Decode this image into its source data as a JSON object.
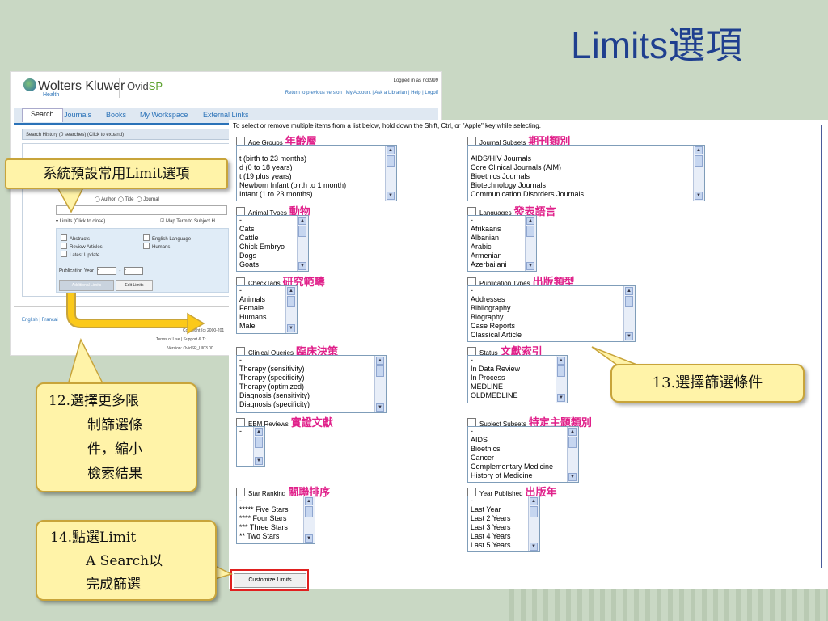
{
  "slide": {
    "title": "Limits選項"
  },
  "ovid": {
    "brand": "Wolters Kluwer",
    "brand_sub": "Health",
    "product_a": "Ovid",
    "product_b": "SP",
    "logged_in": "Logged in as nck999",
    "top_links": "Return to previous version | My Account | Ask a Librarian | Help | Logoff",
    "tabs": [
      "Search",
      "Journals",
      "Books",
      "My Workspace",
      "External Links"
    ],
    "search_history": "Search History (0 searches) (Click to expand)",
    "radio_author": "Author",
    "radio_title": "Title",
    "radio_journal": "Journal",
    "limits_header": "▾ Limits (Click to close)",
    "map_term": "Map Term to Subject H",
    "checks": [
      "Abstracts",
      "Review Articles",
      "Latest Update",
      "English Language",
      "Humans"
    ],
    "publication_year": "Publication Year",
    "year_from": "-",
    "year_to": "-",
    "additional_limits": "Additional Limits",
    "edit_limits": "Edit Limits",
    "lang_links": "English | Françai",
    "footer_copy": "Copyright (c) 2000-201",
    "footer_terms": "Terms of Use | Support & Tr",
    "footer_version": "Version: OvidSP_UI03.00"
  },
  "limits": {
    "instruction": "To select or remove multiple items from a list below, hold down the Shift, Ctrl, or \"Apple\" key while selecting.",
    "customize_button": "Customize Limits",
    "categories": {
      "age_groups": {
        "label": "Age Groups",
        "zh": "年齡層",
        "options": [
          "-",
          "t (birth to 23 months)",
          "d (0 to 18 years)",
          "t (19 plus years)",
          "Newborn Infant (birth to 1 month)",
          "Infant (1 to 23 months)"
        ]
      },
      "journal_subsets": {
        "label": "Journal Subsets",
        "zh": "期刊類別",
        "options": [
          "-",
          "AIDS/HIV Journals",
          "Core Clinical Journals (AIM)",
          "Bioethics Journals",
          "Biotechnology Journals",
          "Communication Disorders Journals"
        ]
      },
      "animal_types": {
        "label": "Animal Types",
        "zh": "動物",
        "options": [
          "-",
          "Cats",
          "Cattle",
          "Chick Embryo",
          "Dogs",
          "Goats"
        ]
      },
      "languages": {
        "label": "Languages",
        "zh": "發表語言",
        "options": [
          "-",
          "Afrikaans",
          "Albanian",
          "Arabic",
          "Armenian",
          "Azerbaijani"
        ]
      },
      "checktags": {
        "label": "CheckTags",
        "zh": "研究範疇",
        "options": [
          "-",
          "Animals",
          "Female",
          "Humans",
          "Male"
        ]
      },
      "publication_types": {
        "label": "Publication Types",
        "zh": "出版類型",
        "options": [
          "-",
          "Addresses",
          "Bibliography",
          "Biography",
          "Case Reports",
          "Classical Article"
        ]
      },
      "clinical_queries": {
        "label": "Clinical Queries",
        "zh": "臨床決策",
        "options": [
          "-",
          "Therapy (sensitivity)",
          "Therapy (specificity)",
          "Therapy (optimized)",
          "Diagnosis (sensitivity)",
          "Diagnosis (specificity)"
        ]
      },
      "status": {
        "label": "Status",
        "zh": "文獻索引",
        "options": [
          "-",
          "In Data Review",
          "In Process",
          "MEDLINE",
          "OLDMEDLINE"
        ]
      },
      "ebm_reviews": {
        "label": "EBM Reviews",
        "zh": "實證文獻",
        "options": [
          "-"
        ]
      },
      "subject_subsets": {
        "label": "Subject Subsets",
        "zh": "特定主題類別",
        "options": [
          "-",
          "AIDS",
          "Bioethics",
          "Cancer",
          "Complementary Medicine",
          "History of Medicine"
        ]
      },
      "star_ranking": {
        "label": "Star Ranking",
        "zh": "關聯排序",
        "options": [
          "-",
          "***** Five Stars",
          "**** Four Stars",
          "*** Three Stars",
          "** Two Stars"
        ]
      },
      "year_published": {
        "label": "Year Published",
        "zh": "出版年",
        "options": [
          "-",
          "Last Year",
          "Last 2 Years",
          "Last 3 Years",
          "Last 4 Years",
          "Last 5 Years"
        ]
      }
    }
  },
  "callouts": {
    "system_default": "系統預設常用Limit選項",
    "step12_lines": [
      "12.選擇更多限",
      "制篩選條",
      "件，縮小",
      "檢索結果"
    ],
    "step13": "13.選擇篩選條件",
    "step14_lines": [
      "14.點選Limit",
      "A Search以",
      "完成篩選"
    ]
  },
  "colors": {
    "title": "#1f3f8f",
    "accent_zh": "#e0208a",
    "callout_bg": "#fff3a8",
    "highlight_frame": "#e0201f",
    "background": "#c9d8c4"
  }
}
